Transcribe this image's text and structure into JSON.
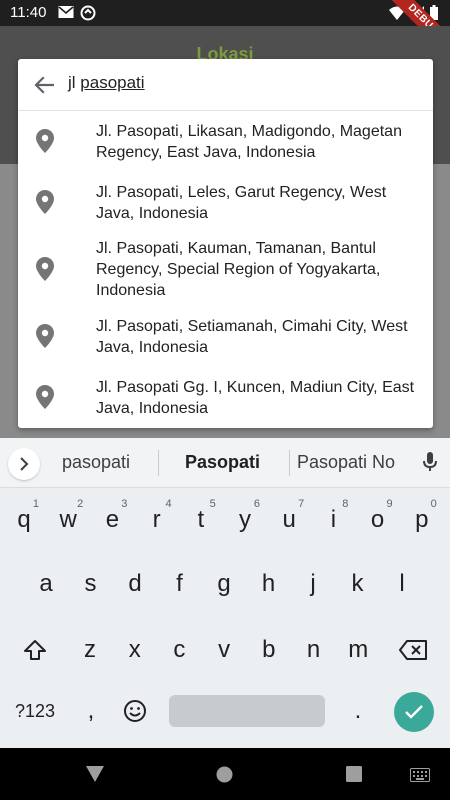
{
  "status_bar": {
    "time": "11:40",
    "icons_left": [
      "mail-icon",
      "data-saver-icon"
    ],
    "icons_right": [
      "wifi-icon",
      "signal-icon",
      "battery-icon"
    ],
    "debug_label": "DEBUG"
  },
  "app": {
    "title": "Lokasi",
    "accent_color": "#7d9b3b"
  },
  "search": {
    "query_prefix": "jl ",
    "query_underlined": "pasopati",
    "results": [
      {
        "text": "Jl. Pasopati, Likasan, Madigondo, Magetan Regency, East Java, Indonesia"
      },
      {
        "text": "Jl. Pasopati, Leles, Garut Regency, West Java, Indonesia"
      },
      {
        "text": "Jl. Pasopati, Kauman, Tamanan, Bantul Regency, Special Region of Yogyakarta, Indonesia"
      },
      {
        "text": "Jl. Pasopati, Setiamanah, Cimahi City, West Java, Indonesia"
      },
      {
        "text": "Jl. Pasopati Gg. I, Kuncen, Madiun City, East Java, Indonesia"
      }
    ]
  },
  "keyboard": {
    "suggestions": [
      "pasopati",
      "Pasopati",
      "Pasopati No"
    ],
    "row1": [
      {
        "k": "q",
        "h": "1"
      },
      {
        "k": "w",
        "h": "2"
      },
      {
        "k": "e",
        "h": "3"
      },
      {
        "k": "r",
        "h": "4"
      },
      {
        "k": "t",
        "h": "5"
      },
      {
        "k": "y",
        "h": "6"
      },
      {
        "k": "u",
        "h": "7"
      },
      {
        "k": "i",
        "h": "8"
      },
      {
        "k": "o",
        "h": "9"
      },
      {
        "k": "p",
        "h": "0"
      }
    ],
    "row2": [
      "a",
      "s",
      "d",
      "f",
      "g",
      "h",
      "j",
      "k",
      "l"
    ],
    "row3": [
      "z",
      "x",
      "c",
      "v",
      "b",
      "n",
      "m"
    ],
    "symbols_label": "?123",
    "comma": ",",
    "period": ".",
    "enter_color": "#3aa99a"
  }
}
